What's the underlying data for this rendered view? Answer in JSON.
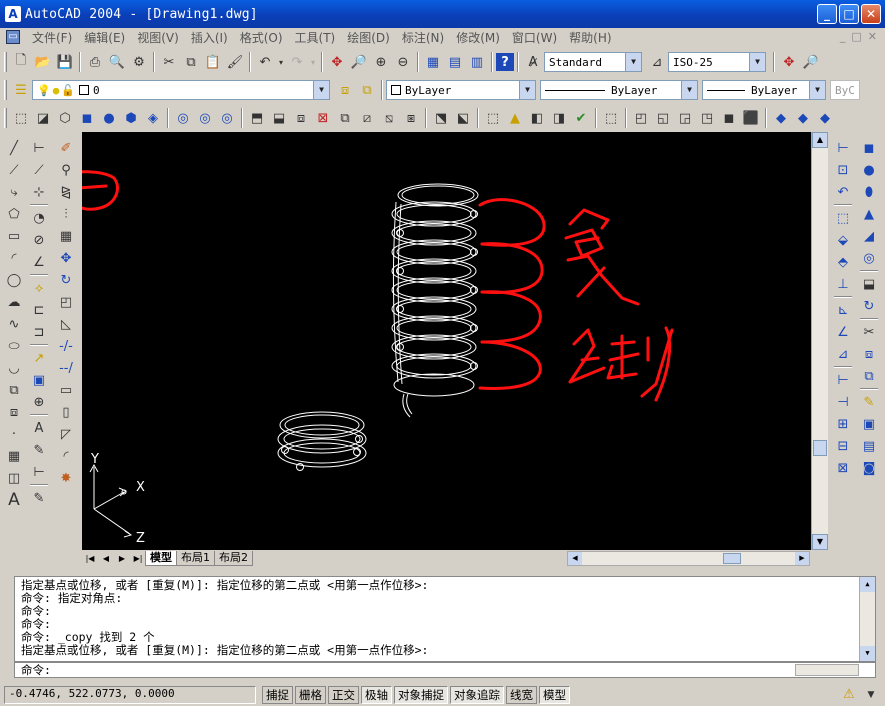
{
  "window": {
    "app_icon": "A",
    "title": "AutoCAD 2004 - [Drawing1.dwg]",
    "minimize": "_",
    "maximize": "□",
    "close": "✕"
  },
  "menu": {
    "items": [
      "文件(F)",
      "编辑(E)",
      "视图(V)",
      "插入(I)",
      "格式(O)",
      "工具(T)",
      "绘图(D)",
      "标注(N)",
      "修改(M)",
      "窗口(W)",
      "帮助(H)"
    ],
    "doc_controls": [
      "_",
      "□",
      "✕"
    ]
  },
  "toolbar_styles": {
    "text_style": "Standard",
    "dim_style": "ISO-25"
  },
  "toolbar_layers": {
    "layer_name": "0",
    "color": "ByLayer",
    "linetype": "ByLayer",
    "lineweight": "ByLayer",
    "plotstyle": "ByC"
  },
  "ucs": {
    "x": "X",
    "y": "Y",
    "z": "Z"
  },
  "annotation_text": "复制",
  "tabs": [
    "模型",
    "布局1",
    "布局2"
  ],
  "command_history": [
    "指定基点或位移, 或者 [重复(M)]: 指定位移的第二点或 <用第一点作位移>:",
    "命令: 指定对角点:",
    "命令:",
    "命令:",
    "命令: _copy 找到 2 个",
    "指定基点或位移, 或者 [重复(M)]: 指定位移的第二点或 <用第一点作位移>:"
  ],
  "command_prompt": "命令:",
  "status": {
    "coordinates": "-0.4746,  522.0773, 0.0000",
    "buttons": [
      {
        "label": "捕捉",
        "on": false
      },
      {
        "label": "栅格",
        "on": false
      },
      {
        "label": "正交",
        "on": false
      },
      {
        "label": "极轴",
        "on": true
      },
      {
        "label": "对象捕捉",
        "on": true
      },
      {
        "label": "对象追踪",
        "on": true
      },
      {
        "label": "线宽",
        "on": false
      },
      {
        "label": "模型",
        "on": true
      }
    ]
  },
  "colors": {
    "titlebar": "#0a3fb8",
    "drawing_bg": "#000000",
    "annotation": "#ff1010",
    "geometry": "#ffffff"
  }
}
